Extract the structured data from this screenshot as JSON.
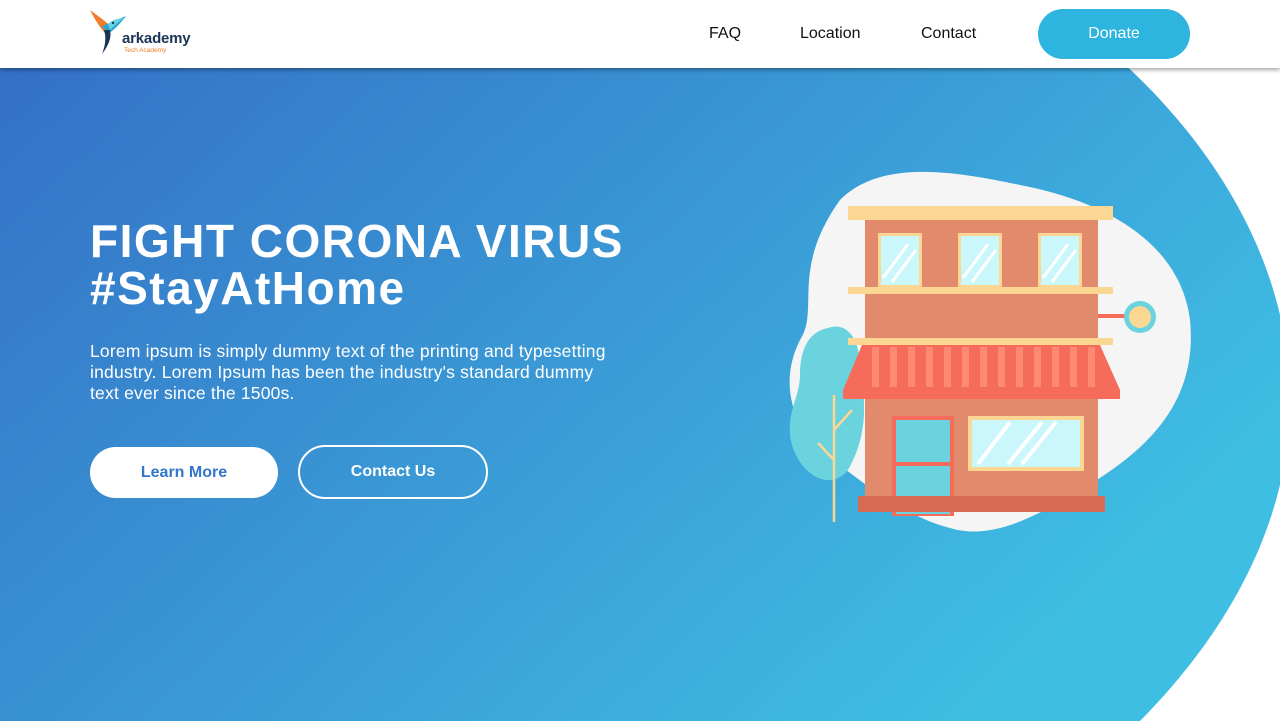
{
  "colors": {
    "hero_gradient_start": "#3470c6",
    "hero_gradient_end": "#3fbee3",
    "donate": "#2db5e0",
    "learn_more_text": "#3377cc",
    "building": "#e28a6c",
    "awning": "#f56d5a",
    "window_glass": "#c9f7fb",
    "trim": "#fcd794",
    "tree": "#6ad3de"
  },
  "header": {
    "logo": {
      "wordmark": "arkademy",
      "subtitle": "Tech Academy",
      "icon": "hummingbird-logo-icon"
    },
    "nav": [
      {
        "label": "FAQ"
      },
      {
        "label": "Location"
      },
      {
        "label": "Contact"
      }
    ],
    "donate_label": "Donate"
  },
  "hero": {
    "title_line1": "FIGHT CORONA VIRUS",
    "title_line2": "#StayAtHome",
    "description": "Lorem ipsum is simply dummy text of the printing and typesetting industry. Lorem Ipsum has been the industry's standard dummy text ever since the 1500s.",
    "learn_more_label": "Learn More",
    "contact_us_label": "Contact Us",
    "illustration": "storefront-building-illustration"
  }
}
